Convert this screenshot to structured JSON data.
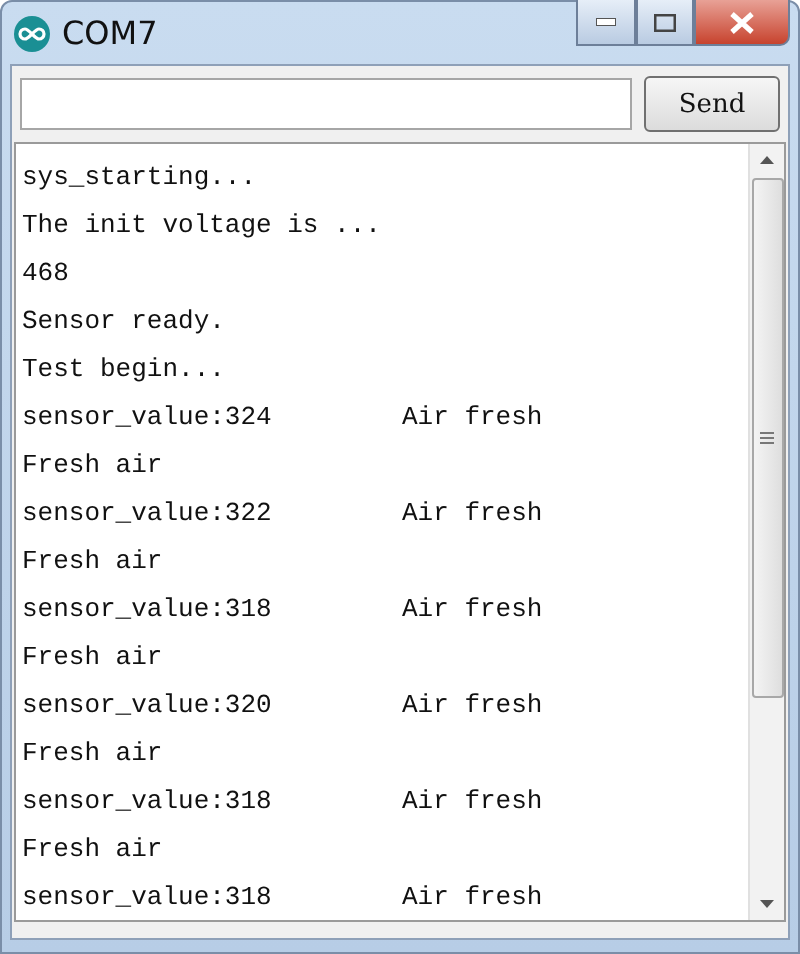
{
  "window": {
    "title": "COM7"
  },
  "send_button": "Send",
  "output": [
    {
      "text": "sys_starting..."
    },
    {
      "text": "The init voltage is ..."
    },
    {
      "text": "468"
    },
    {
      "text": "Sensor ready."
    },
    {
      "text": "Test begin..."
    },
    {
      "text": "sensor_value:324",
      "column_2": "Air fresh"
    },
    {
      "text": "Fresh air"
    },
    {
      "text": "sensor_value:322",
      "column_2": "Air fresh"
    },
    {
      "text": "Fresh air"
    },
    {
      "text": "sensor_value:318",
      "column_2": "Air fresh"
    },
    {
      "text": "Fresh air"
    },
    {
      "text": "sensor_value:320",
      "column_2": "Air fresh"
    },
    {
      "text": "Fresh air"
    },
    {
      "text": "sensor_value:318",
      "column_2": "Air fresh"
    },
    {
      "text": "Fresh air"
    },
    {
      "text": "sensor_value:318",
      "column_2": "Air fresh"
    }
  ]
}
